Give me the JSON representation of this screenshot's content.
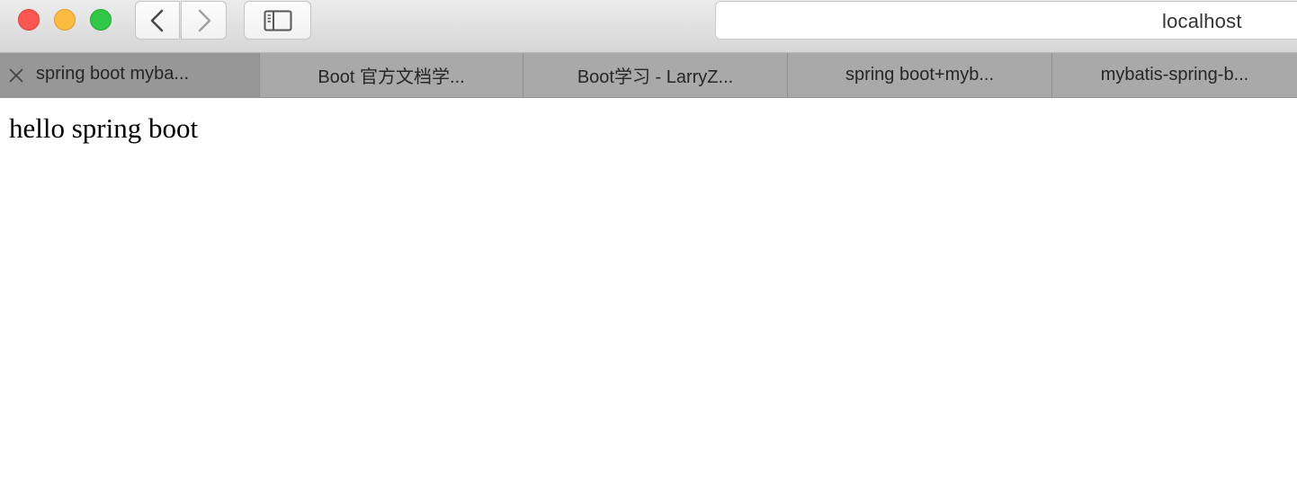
{
  "window": {
    "traffic_lights": {
      "close": "#fc5753",
      "minimize": "#fdbc40",
      "maximize": "#33c748"
    }
  },
  "toolbar": {
    "back_icon": "chevron-left-icon",
    "forward_icon": "chevron-right-icon",
    "sidebar_icon": "sidebar-icon",
    "address": "localhost"
  },
  "tabs": [
    {
      "label": "spring boot myba...",
      "active": true
    },
    {
      "label": "Boot 官方文档学...",
      "active": false
    },
    {
      "label": "Boot学习 - LarryZ...",
      "active": false
    },
    {
      "label": "spring boot+myb...",
      "active": false
    },
    {
      "label": "mybatis-spring-b...",
      "active": false
    }
  ],
  "page": {
    "body_text": "hello spring boot"
  }
}
